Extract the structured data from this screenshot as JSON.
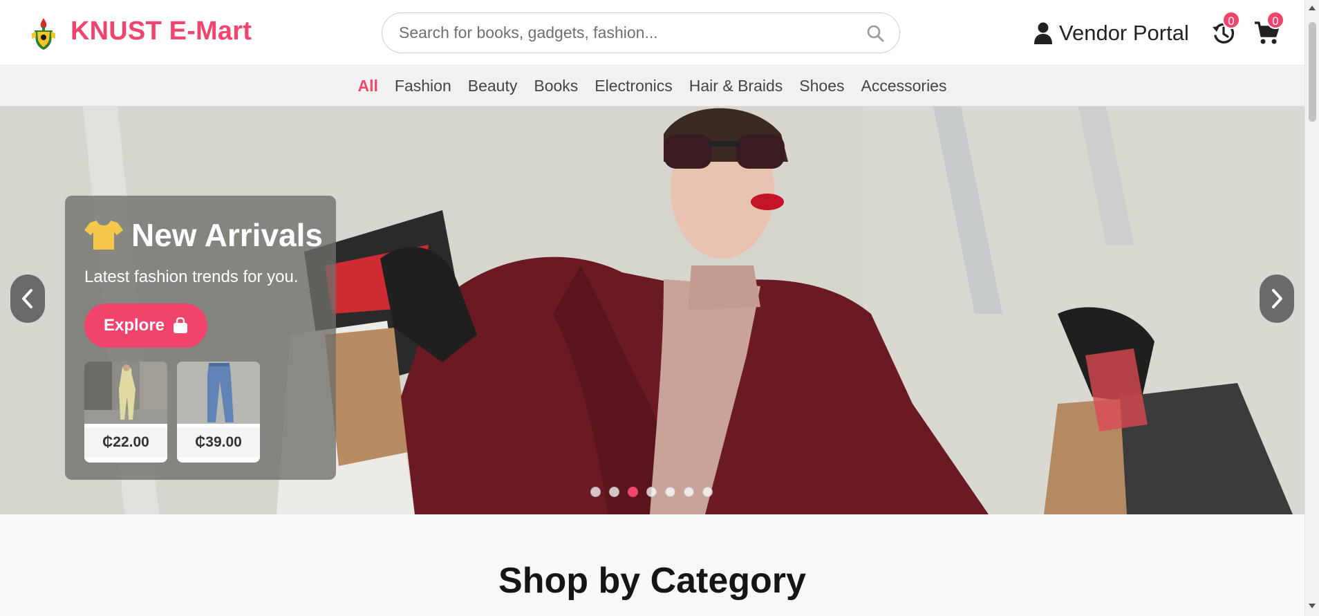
{
  "header": {
    "brand": "KNUST E-Mart",
    "logo_icon": "knust-crest-icon",
    "search": {
      "placeholder": "Search for books, gadgets, fashion...",
      "value": "",
      "icon": "search-icon"
    },
    "vendor_label": "Vendor Portal",
    "history_count": "0",
    "cart_count": "0"
  },
  "categories": {
    "items": [
      "All",
      "Fashion",
      "Beauty",
      "Books",
      "Electronics",
      "Hair & Braids",
      "Shoes",
      "Accessories"
    ],
    "active": "All"
  },
  "hero": {
    "title": "New Arrivals",
    "title_icon": "tshirt-icon",
    "subtitle": "Latest fashion trends for you.",
    "cta_label": "Explore",
    "cta_icon": "shopping-bag-icon",
    "products": [
      {
        "price": "₵22.00"
      },
      {
        "price": "₵39.00"
      }
    ],
    "slide_count": 7,
    "active_slide": 3
  },
  "section": {
    "title": "Shop by Category"
  },
  "colors": {
    "accent": "#f0446c",
    "header_bg": "#ffffff",
    "nav_bg": "#f1f1f1"
  }
}
